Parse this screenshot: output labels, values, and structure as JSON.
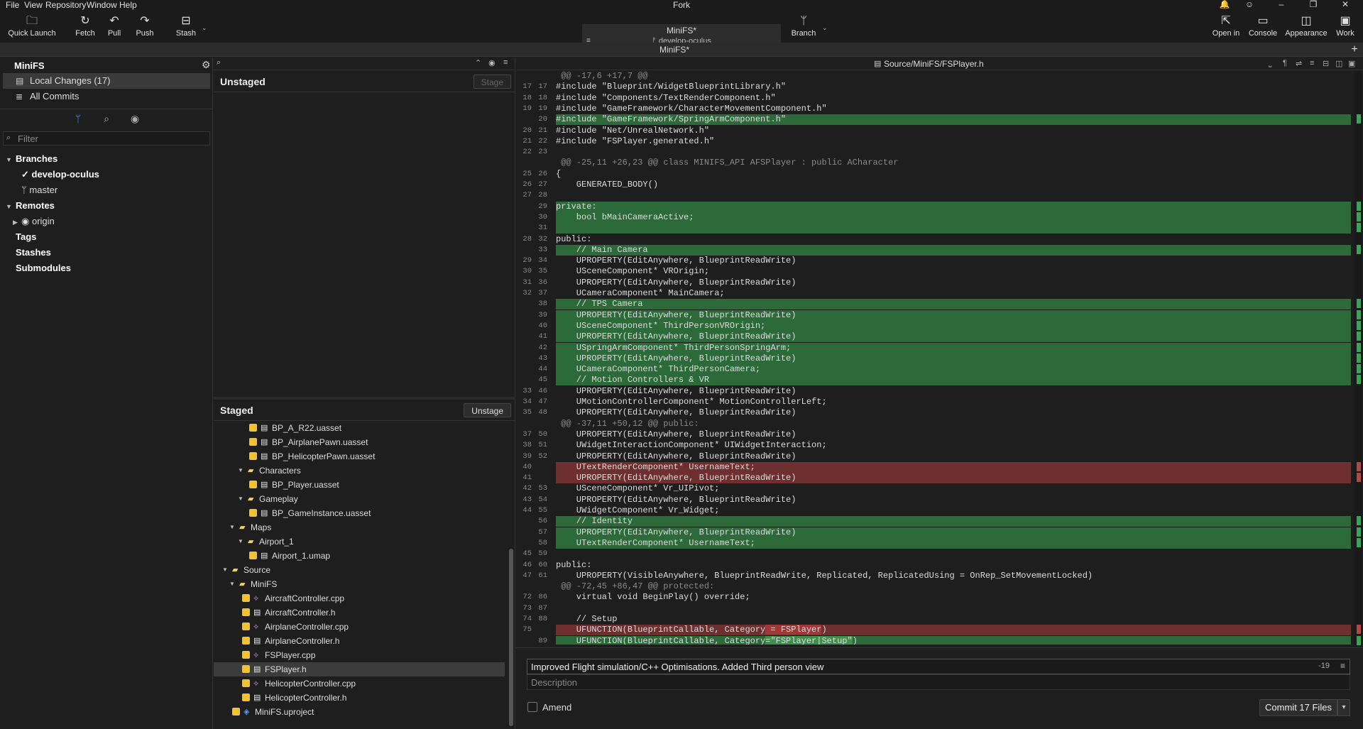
{
  "menu": [
    "File",
    "View",
    "Repository",
    "Window",
    "Help"
  ],
  "app_title": "Fork",
  "window_controls": {
    "bell": "🔔",
    "smile": "☺",
    "minimize": "–",
    "restore": "❐",
    "close": "✕"
  },
  "toolbar": {
    "quick_launch": "Quick Launch",
    "fetch": "Fetch",
    "pull": "Pull",
    "push": "Push",
    "stash": "Stash",
    "branch": "Branch",
    "open_in": "Open in",
    "console": "Console",
    "appearance": "Appearance",
    "work": "Work"
  },
  "repo_switcher": {
    "name": "MiniFS*",
    "branch": "develop-oculus"
  },
  "tab": {
    "label": "MiniFS*"
  },
  "sidebar": {
    "repo_name": "MiniFS",
    "local_changes": "Local Changes (17)",
    "all_commits": "All Commits",
    "filter_placeholder": "Filter",
    "branches": "Branches",
    "branch_items": [
      "develop-oculus",
      "master"
    ],
    "remotes": "Remotes",
    "remote_items": [
      "origin"
    ],
    "tags": "Tags",
    "stashes": "Stashes",
    "submodules": "Submodules"
  },
  "unstaged": {
    "title": "Unstaged",
    "button": "Stage"
  },
  "staged": {
    "title": "Staged",
    "button": "Unstage",
    "files": [
      {
        "name": "BP_A_R22.uasset",
        "kind": "file",
        "checked": true,
        "selected": false
      },
      {
        "name": "BP_AirplanePawn.uasset",
        "kind": "file",
        "checked": true,
        "selected": false
      },
      {
        "name": "BP_HelicopterPawn.uasset",
        "kind": "file",
        "checked": true,
        "selected": false
      },
      {
        "name": "Characters",
        "kind": "folder",
        "checked": false,
        "selected": false
      },
      {
        "name": "BP_Player.uasset",
        "kind": "file",
        "checked": true,
        "selected": false
      },
      {
        "name": "Gameplay",
        "kind": "folder",
        "checked": false,
        "selected": false
      },
      {
        "name": "BP_GameInstance.uasset",
        "kind": "file",
        "checked": true,
        "selected": false
      },
      {
        "name": "Maps",
        "kind": "folder",
        "checked": false,
        "selected": false
      },
      {
        "name": "Airport_1",
        "kind": "folder",
        "checked": false,
        "selected": false
      },
      {
        "name": "Airport_1.umap",
        "kind": "file",
        "checked": true,
        "selected": false
      },
      {
        "name": "Source",
        "kind": "folder",
        "checked": false,
        "selected": false
      },
      {
        "name": "MiniFS",
        "kind": "folder",
        "checked": false,
        "selected": false
      },
      {
        "name": "AircraftController.cpp",
        "kind": "code",
        "checked": true,
        "selected": false
      },
      {
        "name": "AircraftController.h",
        "kind": "header",
        "checked": true,
        "selected": false
      },
      {
        "name": "AirplaneController.cpp",
        "kind": "code",
        "checked": true,
        "selected": false
      },
      {
        "name": "AirplaneController.h",
        "kind": "header",
        "checked": true,
        "selected": false
      },
      {
        "name": "FSPlayer.cpp",
        "kind": "code",
        "checked": true,
        "selected": false
      },
      {
        "name": "FSPlayer.h",
        "kind": "header",
        "checked": true,
        "selected": true
      },
      {
        "name": "HelicopterController.cpp",
        "kind": "code",
        "checked": true,
        "selected": false
      },
      {
        "name": "HelicopterController.h",
        "kind": "header",
        "checked": true,
        "selected": false
      },
      {
        "name": "MiniFS.uproject",
        "kind": "proj",
        "checked": true,
        "selected": false
      }
    ]
  },
  "diff": {
    "path": "Source/MiniFS/FSPlayer.h",
    "lines": [
      {
        "t": "hunk",
        "a": "",
        "b": "",
        "c": " @@ -17,6 +17,7 @@"
      },
      {
        "t": "ctx",
        "a": "17",
        "b": "17",
        "c": "#include \"Blueprint/WidgetBlueprintLibrary.h\""
      },
      {
        "t": "ctx",
        "a": "18",
        "b": "18",
        "c": "#include \"Components/TextRenderComponent.h\""
      },
      {
        "t": "ctx",
        "a": "19",
        "b": "19",
        "c": "#include \"GameFramework/CharacterMovementComponent.h\""
      },
      {
        "t": "add",
        "a": "",
        "b": "20",
        "c": "#include \"GameFramework/SpringArmComponent.h\""
      },
      {
        "t": "ctx",
        "a": "20",
        "b": "21",
        "c": "#include \"Net/UnrealNetwork.h\""
      },
      {
        "t": "ctx",
        "a": "21",
        "b": "22",
        "c": "#include \"FSPlayer.generated.h\""
      },
      {
        "t": "ctx",
        "a": "22",
        "b": "23",
        "c": ""
      },
      {
        "t": "hunk",
        "a": "",
        "b": "",
        "c": " @@ -25,11 +26,23 @@ class MINIFS_API AFSPlayer : public ACharacter"
      },
      {
        "t": "ctx",
        "a": "25",
        "b": "26",
        "c": "{"
      },
      {
        "t": "ctx",
        "a": "26",
        "b": "27",
        "c": "    GENERATED_BODY()"
      },
      {
        "t": "ctx",
        "a": "27",
        "b": "28",
        "c": ""
      },
      {
        "t": "add",
        "a": "",
        "b": "29",
        "c": "private:"
      },
      {
        "t": "add",
        "a": "",
        "b": "30",
        "c": "    bool bMainCameraActive;"
      },
      {
        "t": "add",
        "a": "",
        "b": "31",
        "c": ""
      },
      {
        "t": "ctx",
        "a": "28",
        "b": "32",
        "c": "public:"
      },
      {
        "t": "add",
        "a": "",
        "b": "33",
        "c": "    // Main Camera"
      },
      {
        "t": "ctx",
        "a": "29",
        "b": "34",
        "c": "    UPROPERTY(EditAnywhere, BlueprintReadWrite)"
      },
      {
        "t": "ctx",
        "a": "30",
        "b": "35",
        "c": "    USceneComponent* VROrigin;"
      },
      {
        "t": "ctx",
        "a": "31",
        "b": "36",
        "c": "    UPROPERTY(EditAnywhere, BlueprintReadWrite)"
      },
      {
        "t": "ctx",
        "a": "32",
        "b": "37",
        "c": "    UCameraComponent* MainCamera;"
      },
      {
        "t": "add",
        "a": "",
        "b": "38",
        "c": "    // TPS Camera"
      },
      {
        "t": "add",
        "a": "",
        "b": "39",
        "c": "    UPROPERTY(EditAnywhere, BlueprintReadWrite)"
      },
      {
        "t": "add",
        "a": "",
        "b": "40",
        "c": "    USceneComponent* ThirdPersonVROrigin;"
      },
      {
        "t": "add",
        "a": "",
        "b": "41",
        "c": "    UPROPERTY(EditAnywhere, BlueprintReadWrite)"
      },
      {
        "t": "add",
        "a": "",
        "b": "42",
        "c": "    USpringArmComponent* ThirdPersonSpringArm;"
      },
      {
        "t": "add",
        "a": "",
        "b": "43",
        "c": "    UPROPERTY(EditAnywhere, BlueprintReadWrite)"
      },
      {
        "t": "add",
        "a": "",
        "b": "44",
        "c": "    UCameraComponent* ThirdPersonCamera;"
      },
      {
        "t": "add",
        "a": "",
        "b": "45",
        "c": "    // Motion Controllers & VR"
      },
      {
        "t": "ctx",
        "a": "33",
        "b": "46",
        "c": "    UPROPERTY(EditAnywhere, BlueprintReadWrite)"
      },
      {
        "t": "ctx",
        "a": "34",
        "b": "47",
        "c": "    UMotionControllerComponent* MotionControllerLeft;"
      },
      {
        "t": "ctx",
        "a": "35",
        "b": "48",
        "c": "    UPROPERTY(EditAnywhere, BlueprintReadWrite)"
      },
      {
        "t": "hunk",
        "a": "",
        "b": "",
        "c": " @@ -37,11 +50,12 @@ public:"
      },
      {
        "t": "ctx",
        "a": "37",
        "b": "50",
        "c": "    UPROPERTY(EditAnywhere, BlueprintReadWrite)"
      },
      {
        "t": "ctx",
        "a": "38",
        "b": "51",
        "c": "    UWidgetInteractionComponent* UIWidgetInteraction;"
      },
      {
        "t": "ctx",
        "a": "39",
        "b": "52",
        "c": "    UPROPERTY(EditAnywhere, BlueprintReadWrite)"
      },
      {
        "t": "del",
        "a": "40",
        "b": "",
        "c": "    UTextRenderComponent* UsernameText;"
      },
      {
        "t": "del",
        "a": "41",
        "b": "",
        "c": "    UPROPERTY(EditAnywhere, BlueprintReadWrite)"
      },
      {
        "t": "ctx",
        "a": "42",
        "b": "53",
        "c": "    USceneComponent* Vr_UIPivot;"
      },
      {
        "t": "ctx",
        "a": "43",
        "b": "54",
        "c": "    UPROPERTY(EditAnywhere, BlueprintReadWrite)"
      },
      {
        "t": "ctx",
        "a": "44",
        "b": "55",
        "c": "    UWidgetComponent* Vr_Widget;"
      },
      {
        "t": "add",
        "a": "",
        "b": "56",
        "c": "    // Identity"
      },
      {
        "t": "add",
        "a": "",
        "b": "57",
        "c": "    UPROPERTY(EditAnywhere, BlueprintReadWrite)"
      },
      {
        "t": "add",
        "a": "",
        "b": "58",
        "c": "    UTextRenderComponent* UsernameText;"
      },
      {
        "t": "ctx",
        "a": "45",
        "b": "59",
        "c": ""
      },
      {
        "t": "ctx",
        "a": "46",
        "b": "60",
        "c": "public:"
      },
      {
        "t": "ctx",
        "a": "47",
        "b": "61",
        "c": "    UPROPERTY(VisibleAnywhere, BlueprintReadWrite, Replicated, ReplicatedUsing = OnRep_SetMovementLocked)"
      },
      {
        "t": "hunk",
        "a": "",
        "b": "",
        "c": " @@ -72,45 +86,47 @@ protected:"
      },
      {
        "t": "ctx",
        "a": "72",
        "b": "86",
        "c": "    virtual void BeginPlay() override;"
      },
      {
        "t": "ctx",
        "a": "73",
        "b": "87",
        "c": ""
      },
      {
        "t": "ctx",
        "a": "74",
        "b": "88",
        "c": "    // Setup"
      },
      {
        "t": "del",
        "a": "75",
        "b": "",
        "c": "    UFUNCTION(BlueprintCallable, Category",
        "hl": " = FSPlayer",
        "tail": ")"
      },
      {
        "t": "add",
        "a": "",
        "b": "89",
        "c": "    UFUNCTION(BlueprintCallable, Category",
        "hl": "=\"FSPlayer|Setup\"",
        "tail": ")"
      },
      {
        "t": "ctx",
        "a": "76",
        "b": "90",
        "c": "    void SetupLocalPlayer();"
      }
    ]
  },
  "commit": {
    "summary": "Improved Flight simulation/C++ Optimisations. Added Third person view",
    "char_count": "-19",
    "description_placeholder": "Description",
    "amend": "Amend",
    "button": "Commit 17 Files"
  }
}
